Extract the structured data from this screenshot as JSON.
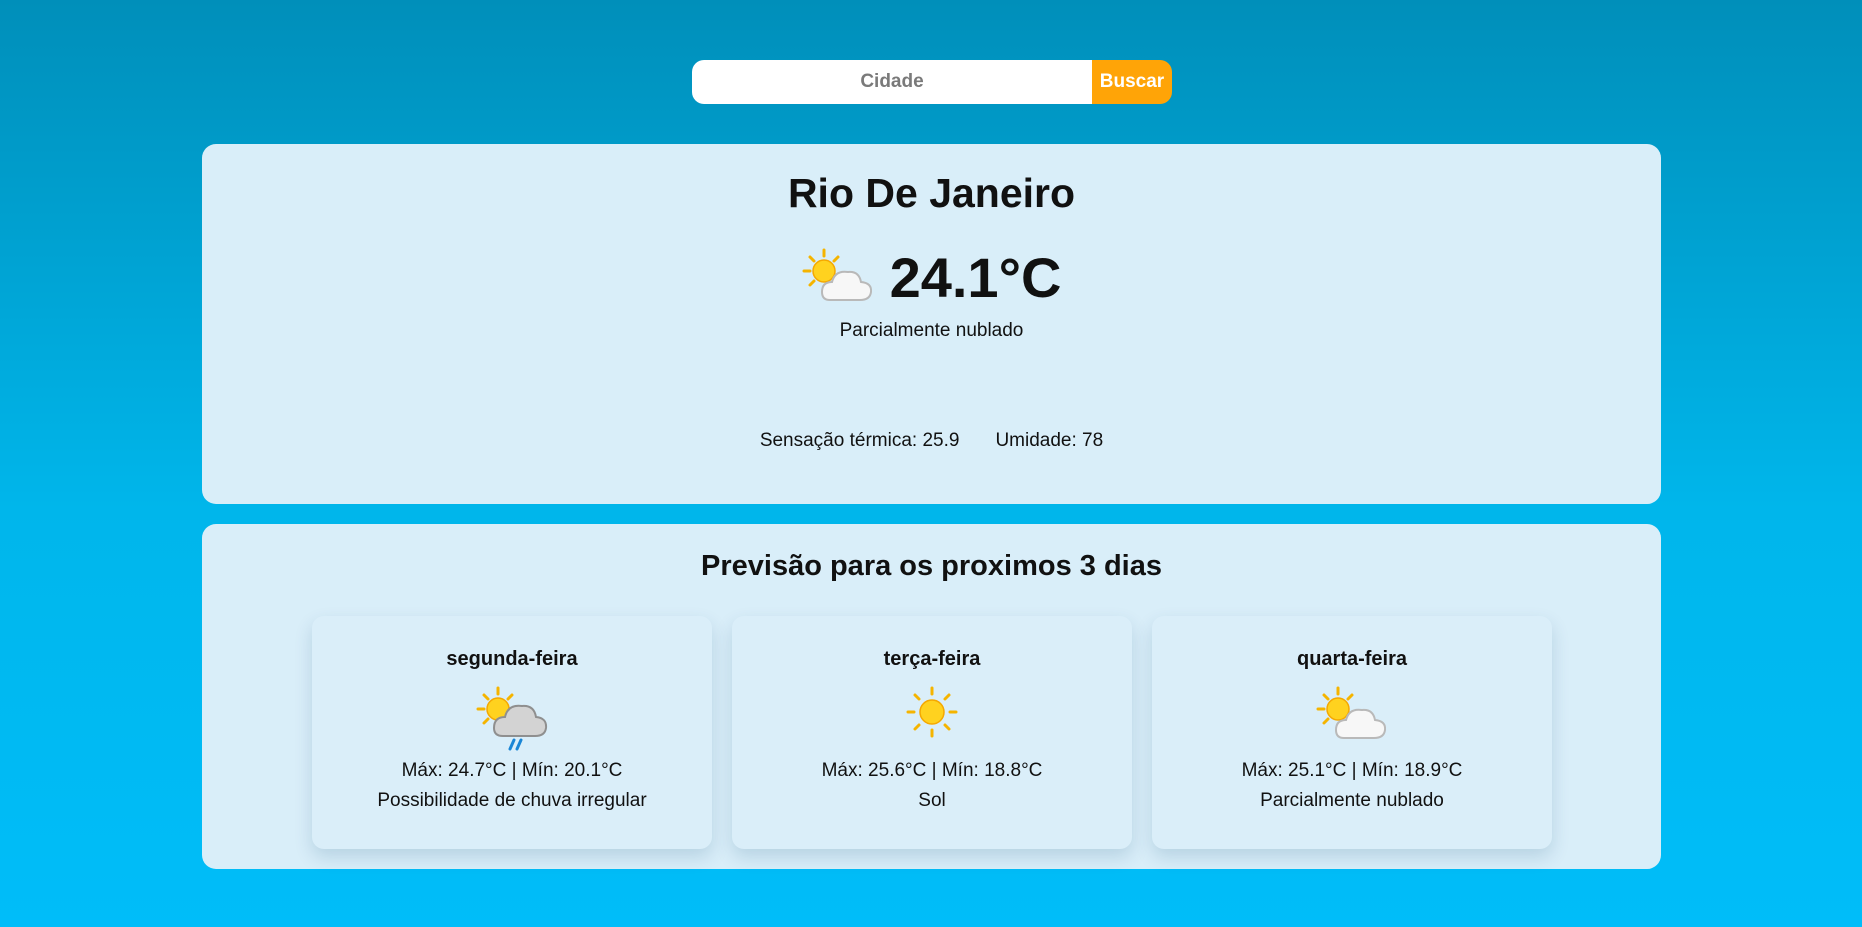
{
  "search": {
    "placeholder": "Cidade",
    "value": "",
    "button_label": "Buscar"
  },
  "current": {
    "city": "Rio De Janeiro",
    "icon": "partly-cloudy-icon",
    "temperature": "24.1°C",
    "condition": "Parcialmente nublado",
    "feels_like": "Sensação térmica: 25.9",
    "humidity": "Umidade: 78"
  },
  "forecast": {
    "title": "Previsão para os proximos 3 dias",
    "days": [
      {
        "name": "segunda-feira",
        "icon": "patchy-rain-icon",
        "temps": "Máx: 24.7°C | Mín: 20.1°C",
        "condition": "Possibilidade de chuva irregular"
      },
      {
        "name": "terça-feira",
        "icon": "sun-icon",
        "temps": "Máx: 25.6°C | Mín: 18.8°C",
        "condition": "Sol"
      },
      {
        "name": "quarta-feira",
        "icon": "partly-cloudy-icon",
        "temps": "Máx: 25.1°C | Mín: 18.9°C",
        "condition": "Parcialmente nublado"
      }
    ]
  },
  "colors": {
    "accent": "#ffa407",
    "panel": "#d9eef9",
    "background_top": "#008fba",
    "background_bottom": "#00bdf9"
  }
}
